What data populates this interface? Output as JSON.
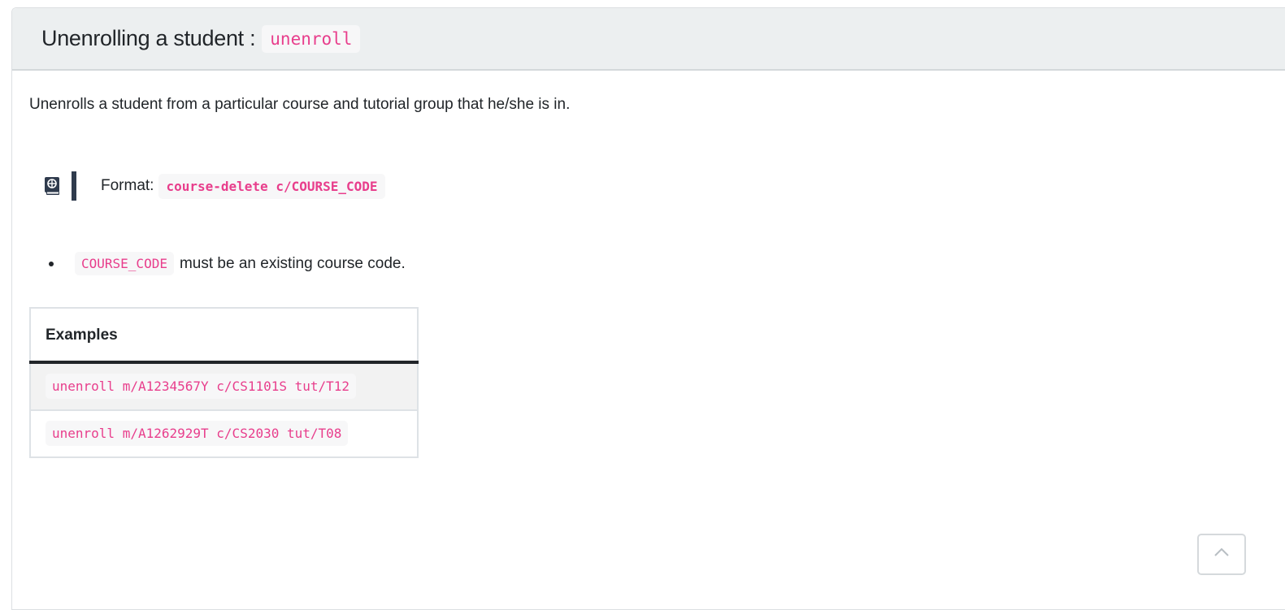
{
  "header": {
    "title": "Unenrolling a student :",
    "command": "unenroll"
  },
  "description": "Unenrolls a student from a particular course and tutorial group that he/she is in.",
  "format": {
    "icon": "book-globe-icon",
    "label": "Format:",
    "code": "course-delete c/COURSE_CODE"
  },
  "notes": [
    {
      "code": "COURSE_CODE",
      "text": "must be an existing course code."
    }
  ],
  "examples": {
    "header": "Examples",
    "rows": [
      "unenroll m/A1234567Y c/CS1101S tut/T12",
      "unenroll m/A1262929T c/CS2030 tut/T08"
    ]
  },
  "back_to_top": {
    "icon": "chevron-up-icon"
  }
}
